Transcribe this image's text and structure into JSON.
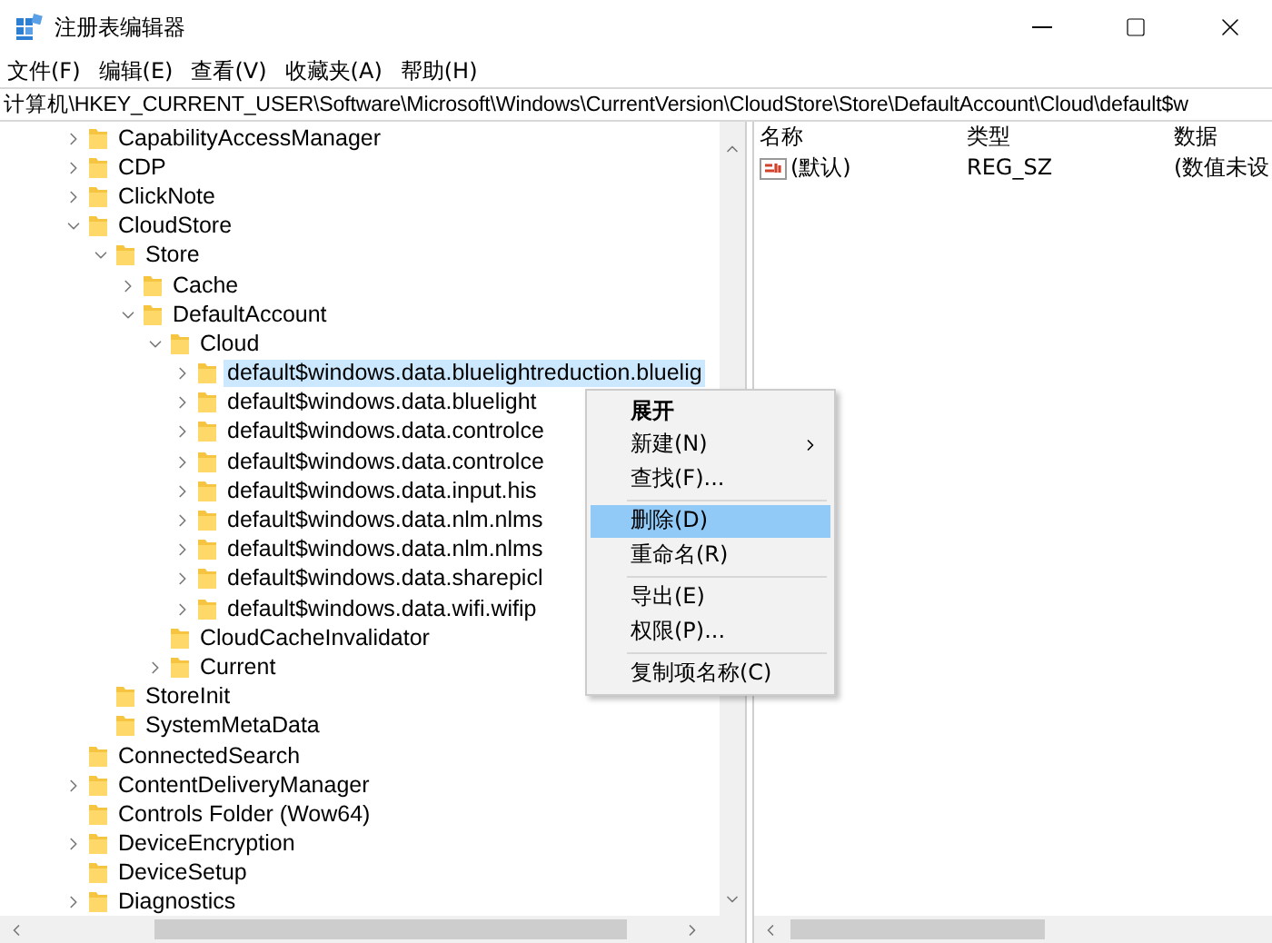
{
  "window": {
    "title": "注册表编辑器"
  },
  "menu_bar": [
    "文件(F)",
    "编辑(E)",
    "查看(V)",
    "收藏夹(A)",
    "帮助(H)"
  ],
  "address": "计算机\\HKEY_CURRENT_USER\\Software\\Microsoft\\Windows\\CurrentVersion\\CloudStore\\Store\\DefaultAccount\\Cloud\\default$w",
  "tree": [
    {
      "label": "CapabilityAccessManager",
      "kind": "node",
      "expanded": false,
      "selected": false
    },
    {
      "label": "CDP",
      "kind": "node",
      "expanded": false,
      "selected": false
    },
    {
      "label": "ClickNote",
      "kind": "node",
      "expanded": false,
      "selected": false
    },
    {
      "label": "CloudStore",
      "kind": "node",
      "expanded": true,
      "selected": false,
      "children": [
        {
          "label": "Store",
          "kind": "node",
          "expanded": true,
          "selected": false,
          "children": [
            {
              "label": "Cache",
              "kind": "node",
              "expanded": false,
              "selected": false
            },
            {
              "label": "DefaultAccount",
              "kind": "node",
              "expanded": true,
              "selected": false,
              "children": [
                {
                  "label": "Cloud",
                  "kind": "node",
                  "expanded": true,
                  "selected": false,
                  "children": [
                    {
                      "label": "default$windows.data.bluelightreduction.bluelig",
                      "kind": "node",
                      "expanded": false,
                      "selected": true
                    },
                    {
                      "label": "default$windows.data.bluelight",
                      "kind": "node",
                      "expanded": false,
                      "selected": false
                    },
                    {
                      "label": "default$windows.data.controlce",
                      "kind": "node",
                      "expanded": false,
                      "selected": false
                    },
                    {
                      "label": "default$windows.data.controlce",
                      "kind": "node",
                      "expanded": false,
                      "selected": false
                    },
                    {
                      "label": "default$windows.data.input.his",
                      "kind": "node",
                      "expanded": false,
                      "selected": false
                    },
                    {
                      "label": "default$windows.data.nlm.nlms",
                      "kind": "node",
                      "expanded": false,
                      "selected": false
                    },
                    {
                      "label": "default$windows.data.nlm.nlms",
                      "kind": "node",
                      "expanded": false,
                      "selected": false
                    },
                    {
                      "label": "default$windows.data.sharepicl",
                      "kind": "node",
                      "expanded": false,
                      "selected": false
                    },
                    {
                      "label": "default$windows.data.wifi.wifip",
                      "kind": "node",
                      "expanded": false,
                      "selected": false
                    }
                  ]
                },
                {
                  "label": "CloudCacheInvalidator",
                  "kind": "leaf",
                  "selected": false
                },
                {
                  "label": "Current",
                  "kind": "node",
                  "expanded": false,
                  "selected": false
                }
              ]
            }
          ]
        },
        {
          "label": "StoreInit",
          "kind": "leaf",
          "selected": false
        },
        {
          "label": "SystemMetaData",
          "kind": "leaf",
          "selected": false
        }
      ]
    },
    {
      "label": "ConnectedSearch",
      "kind": "leaf",
      "selected": false
    },
    {
      "label": "ContentDeliveryManager",
      "kind": "node",
      "expanded": false,
      "selected": false
    },
    {
      "label": "Controls Folder (Wow64)",
      "kind": "leaf",
      "selected": false
    },
    {
      "label": "DeviceEncryption",
      "kind": "node",
      "expanded": false,
      "selected": false
    },
    {
      "label": "DeviceSetup",
      "kind": "leaf",
      "selected": false
    },
    {
      "label": "Diagnostics",
      "kind": "node",
      "expanded": false,
      "selected": false
    }
  ],
  "values": {
    "columns": [
      "名称",
      "类型",
      "数据"
    ],
    "rows": [
      {
        "name": "(默认)",
        "type": "REG_SZ",
        "data": "(数值未设"
      }
    ]
  },
  "context_menu": [
    {
      "kind": "item",
      "label": "展开",
      "bold": true,
      "submenu": false,
      "selected": false
    },
    {
      "kind": "item",
      "label": "新建(N)",
      "bold": false,
      "submenu": true,
      "selected": false
    },
    {
      "kind": "item",
      "label": "查找(F)...",
      "bold": false,
      "submenu": false,
      "selected": false
    },
    {
      "kind": "separator"
    },
    {
      "kind": "item",
      "label": "删除(D)",
      "bold": false,
      "submenu": false,
      "selected": true
    },
    {
      "kind": "item",
      "label": "重命名(R)",
      "bold": false,
      "submenu": false,
      "selected": false
    },
    {
      "kind": "separator"
    },
    {
      "kind": "item",
      "label": "导出(E)",
      "bold": false,
      "submenu": false,
      "selected": false
    },
    {
      "kind": "item",
      "label": "权限(P)...",
      "bold": false,
      "submenu": false,
      "selected": false
    },
    {
      "kind": "separator"
    },
    {
      "kind": "item",
      "label": "复制项名称(C)",
      "bold": false,
      "submenu": false,
      "selected": false
    }
  ]
}
